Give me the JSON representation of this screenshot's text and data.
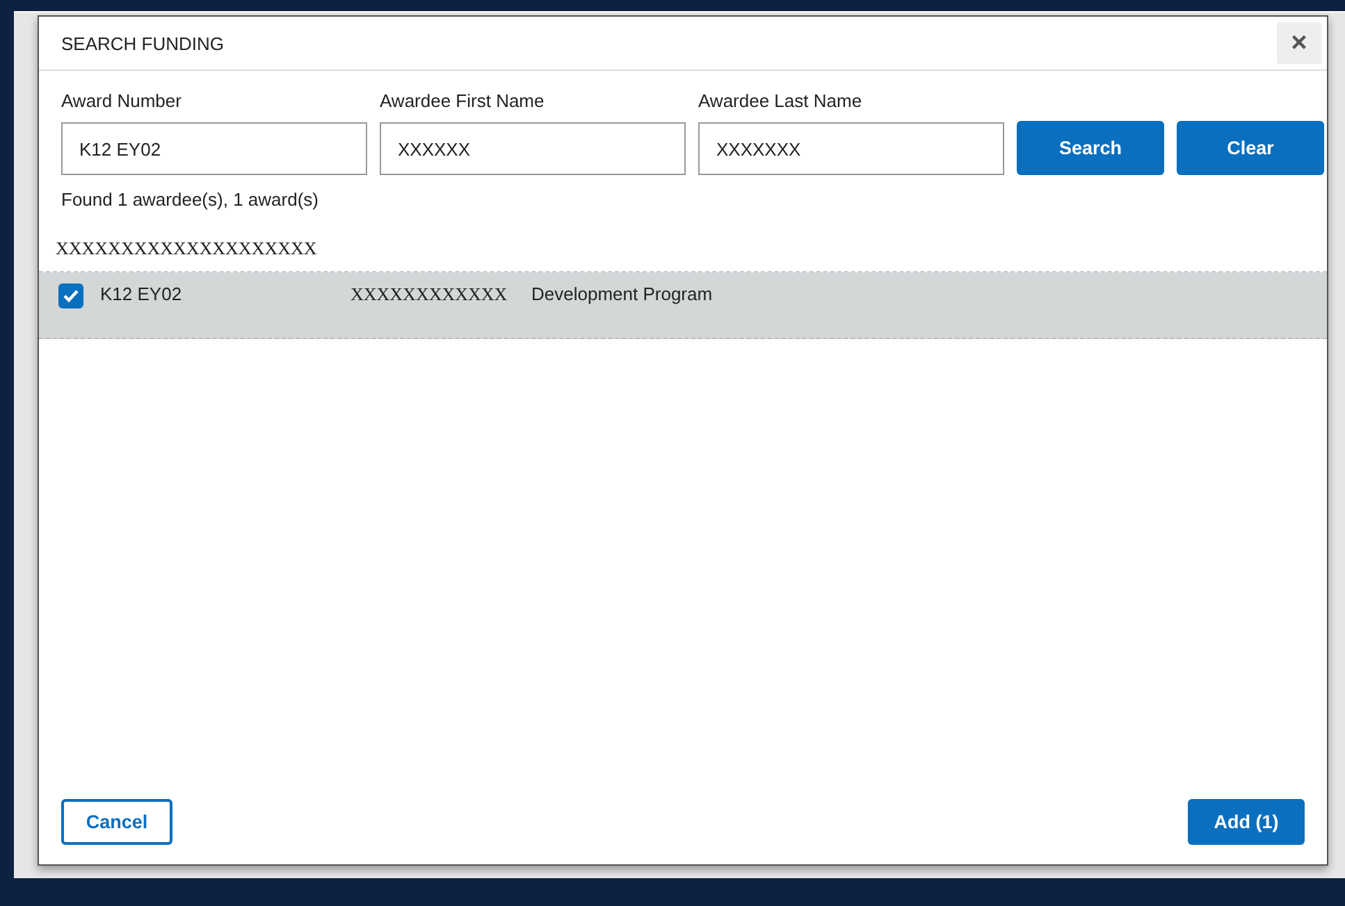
{
  "dialog": {
    "title": "SEARCH FUNDING",
    "close": "×"
  },
  "fields": [
    {
      "label": "Award Number",
      "value": "K12 EY02"
    },
    {
      "label": "Awardee First Name",
      "value": "XXXXXX"
    },
    {
      "label": "Awardee Last Name",
      "value": "XXXXXXX"
    }
  ],
  "buttons": [
    "Search",
    "Clear"
  ],
  "result_summary": "Found 1 awardee(s), 1 award(s)",
  "awardee": "XXXXXXXXXXXXXXXXXXXX",
  "awards": [
    {
      "award_number": "K12 EY02",
      "column_2": "XXXXXXXXXXXX",
      "title": "Development Program",
      "checked": true
    }
  ],
  "footer": {
    "cancel": "Cancel",
    "add": "Add (1)"
  }
}
